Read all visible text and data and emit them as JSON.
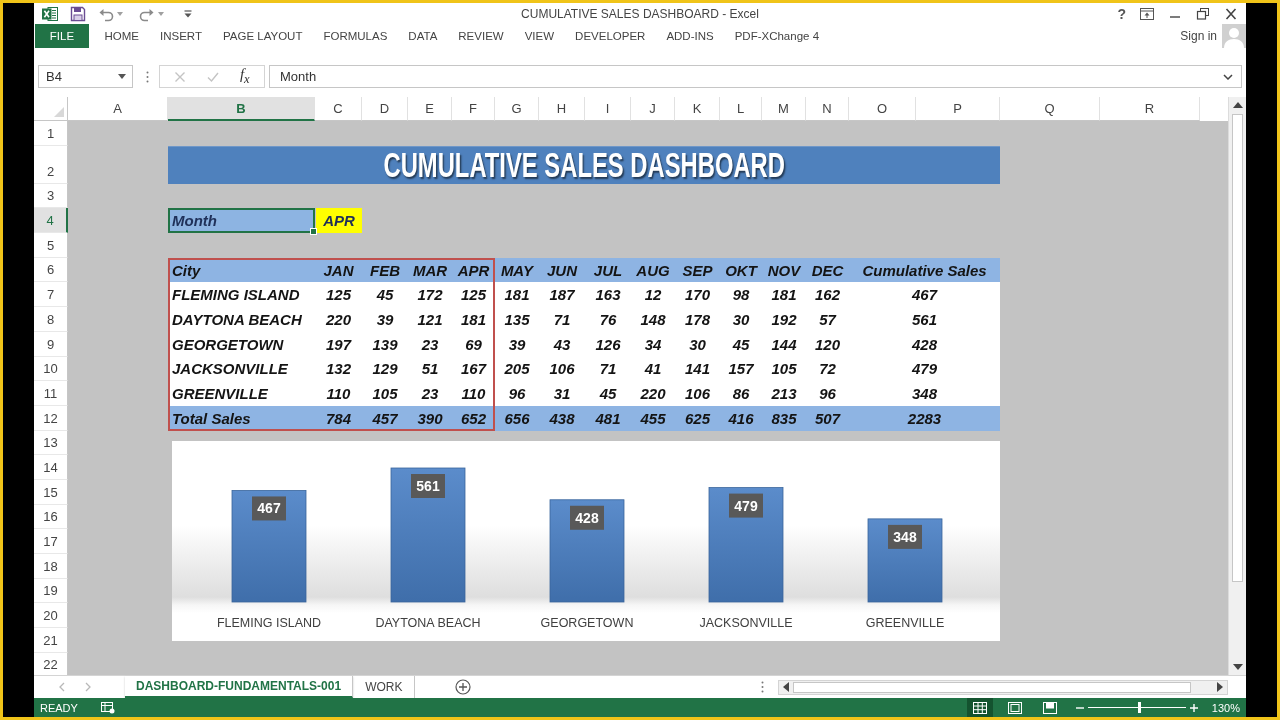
{
  "window": {
    "title": "CUMULATIVE SALES DASHBOARD - Excel",
    "help": "?"
  },
  "ribbon_tabs": [
    {
      "label": "FILE",
      "kind": "file"
    },
    {
      "label": "HOME",
      "kind": "tab"
    },
    {
      "label": "INSERT",
      "kind": "tab"
    },
    {
      "label": "PAGE LAYOUT",
      "kind": "tab"
    },
    {
      "label": "FORMULAS",
      "kind": "tab"
    },
    {
      "label": "DATA",
      "kind": "tab"
    },
    {
      "label": "REVIEW",
      "kind": "tab"
    },
    {
      "label": "VIEW",
      "kind": "tab"
    },
    {
      "label": "DEVELOPER",
      "kind": "tab"
    },
    {
      "label": "ADD-INS",
      "kind": "tab"
    },
    {
      "label": "PDF-XChange 4",
      "kind": "tab"
    }
  ],
  "account": {
    "label": "Sign in"
  },
  "formula_bar": {
    "name_box": "B4",
    "function_button": "f$_{x}$",
    "formula": "Month"
  },
  "column_headers": [
    {
      "label": "A",
      "selected": false
    },
    {
      "label": "B",
      "selected": true
    },
    {
      "label": "C",
      "selected": false
    },
    {
      "label": "D",
      "selected": false
    },
    {
      "label": "E",
      "selected": false
    },
    {
      "label": "F",
      "selected": false
    },
    {
      "label": "G",
      "selected": false
    },
    {
      "label": "H",
      "selected": false
    },
    {
      "label": "I",
      "selected": false
    },
    {
      "label": "J",
      "selected": false
    },
    {
      "label": "K",
      "selected": false
    },
    {
      "label": "L",
      "selected": false
    },
    {
      "label": "M",
      "selected": false
    },
    {
      "label": "N",
      "selected": false
    },
    {
      "label": "O",
      "selected": false
    },
    {
      "label": "P",
      "selected": false
    },
    {
      "label": "Q",
      "selected": false
    },
    {
      "label": "R",
      "selected": false
    }
  ],
  "row_headers": [
    {
      "label": "1",
      "selected": false
    },
    {
      "label": "2",
      "selected": false
    },
    {
      "label": "3",
      "selected": false
    },
    {
      "label": "4",
      "selected": true
    },
    {
      "label": "5",
      "selected": false
    },
    {
      "label": "6",
      "selected": false
    },
    {
      "label": "7",
      "selected": false
    },
    {
      "label": "8",
      "selected": false
    },
    {
      "label": "9",
      "selected": false
    },
    {
      "label": "10",
      "selected": false
    },
    {
      "label": "11",
      "selected": false
    },
    {
      "label": "12",
      "selected": false
    },
    {
      "label": "13",
      "selected": false
    },
    {
      "label": "14",
      "selected": false
    },
    {
      "label": "15",
      "selected": false
    },
    {
      "label": "16",
      "selected": false
    },
    {
      "label": "17",
      "selected": false
    },
    {
      "label": "18",
      "selected": false
    },
    {
      "label": "19",
      "selected": false
    },
    {
      "label": "20",
      "selected": false
    },
    {
      "label": "21",
      "selected": false
    },
    {
      "label": "22",
      "selected": false
    }
  ],
  "sheet": {
    "banner": "CUMULATIVE SALES DASHBOARD",
    "month_label": {
      "text": "Month",
      "selected": true
    },
    "month_value": "APR",
    "table": {
      "columns": [
        {
          "label": "City",
          "highlighted": true
        },
        {
          "label": "JAN",
          "highlighted": true
        },
        {
          "label": "FEB",
          "highlighted": true
        },
        {
          "label": "MAR",
          "highlighted": true
        },
        {
          "label": "APR",
          "highlighted": true
        },
        {
          "label": "MAY",
          "highlighted": false
        },
        {
          "label": "JUN",
          "highlighted": false
        },
        {
          "label": "JUL",
          "highlighted": false
        },
        {
          "label": "AUG",
          "highlighted": false
        },
        {
          "label": "SEP",
          "highlighted": false
        },
        {
          "label": "OKT",
          "highlighted": false
        },
        {
          "label": "NOV",
          "highlighted": false
        },
        {
          "label": "DEC",
          "highlighted": false
        },
        {
          "label": "Cumulative Sales",
          "highlighted": false
        }
      ],
      "rows": [
        [
          "FLEMING ISLAND",
          "125",
          "45",
          "172",
          "125",
          "181",
          "187",
          "163",
          "12",
          "170",
          "98",
          "181",
          "162",
          "467"
        ],
        [
          "DAYTONA BEACH",
          "220",
          "39",
          "121",
          "181",
          "135",
          "71",
          "76",
          "148",
          "178",
          "30",
          "192",
          "57",
          "561"
        ],
        [
          "GEORGETOWN",
          "197",
          "139",
          "23",
          "69",
          "39",
          "43",
          "126",
          "34",
          "30",
          "45",
          "144",
          "120",
          "428"
        ],
        [
          "JACKSONVILLE",
          "132",
          "129",
          "51",
          "167",
          "205",
          "106",
          "71",
          "41",
          "141",
          "157",
          "105",
          "72",
          "479"
        ],
        [
          "GREENVILLE",
          "110",
          "105",
          "23",
          "110",
          "96",
          "31",
          "45",
          "220",
          "106",
          "86",
          "213",
          "96",
          "348"
        ]
      ],
      "total": [
        "Total Sales",
        "784",
        "457",
        "390",
        "652",
        "656",
        "438",
        "481",
        "455",
        "625",
        "416",
        "835",
        "507",
        "2283"
      ]
    },
    "chart": {
      "chart_data": {
        "type": "bar",
        "categories": [
          "FLEMING ISLAND",
          "DAYTONA BEACH",
          "GEORGETOWN",
          "JACKSONVILLE",
          "GREENVILLE"
        ],
        "values": [
          467,
          561,
          428,
          479,
          348
        ],
        "data_labels": true
      }
    }
  },
  "sheet_tabs": [
    {
      "label": "DASHBOARD-FUNDAMENTALS-001",
      "selected": true
    },
    {
      "label": "WORK",
      "selected": false
    }
  ],
  "status_bar": {
    "mode": "READY",
    "views": [
      {
        "kind": "normal",
        "selected": true
      },
      {
        "kind": "page_layout",
        "selected": false
      },
      {
        "kind": "page_break",
        "selected": false
      }
    ],
    "zoom_slider": {
      "level": 0.52
    },
    "zoom": "130%"
  }
}
